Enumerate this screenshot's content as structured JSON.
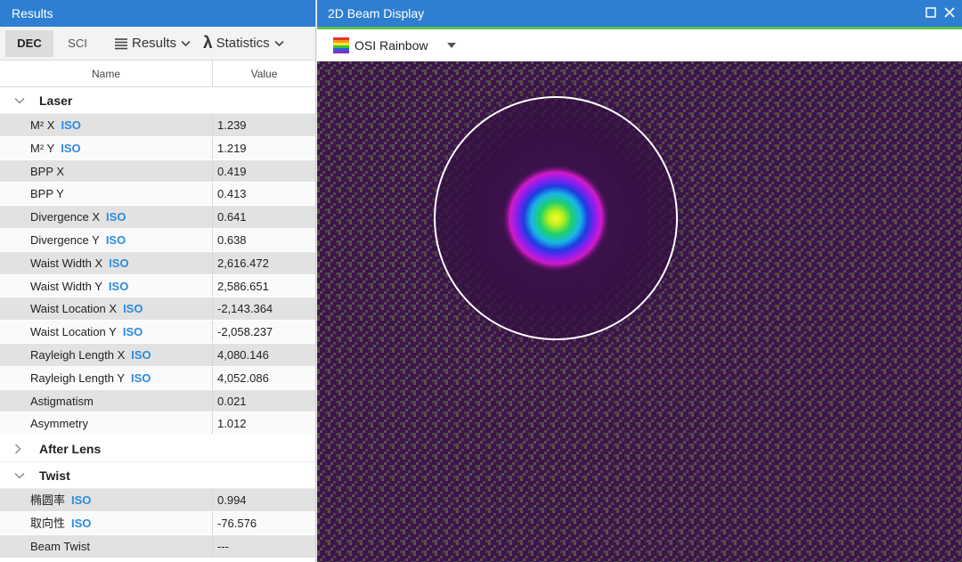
{
  "results": {
    "title": "Results",
    "toolbar": {
      "dec_label": "DEC",
      "sci_label": "SCI",
      "results_menu": "Results",
      "statistics_menu": "Statistics"
    },
    "columns": {
      "name": "Name",
      "value": "Value"
    },
    "iso_badge": "ISO",
    "groups": {
      "laser": {
        "title": "Laser",
        "rows": [
          {
            "name": "M² X",
            "iso": true,
            "value": "1.239"
          },
          {
            "name": "M² Y",
            "iso": true,
            "value": "1.219"
          },
          {
            "name": "BPP X",
            "iso": false,
            "value": "0.419"
          },
          {
            "name": "BPP Y",
            "iso": false,
            "value": "0.413"
          },
          {
            "name": "Divergence X",
            "iso": true,
            "value": "0.641"
          },
          {
            "name": "Divergence Y",
            "iso": true,
            "value": "0.638"
          },
          {
            "name": "Waist Width X",
            "iso": true,
            "value": "2,616.472"
          },
          {
            "name": "Waist Width Y",
            "iso": true,
            "value": "2,586.651"
          },
          {
            "name": "Waist Location X",
            "iso": true,
            "value": "-2,143.364"
          },
          {
            "name": "Waist Location Y",
            "iso": true,
            "value": "-2,058.237"
          },
          {
            "name": "Rayleigh Length X",
            "iso": true,
            "value": "4,080.146"
          },
          {
            "name": "Rayleigh Length Y",
            "iso": true,
            "value": "4,052.086"
          },
          {
            "name": "Astigmatism",
            "iso": false,
            "value": "0.021"
          },
          {
            "name": "Asymmetry",
            "iso": false,
            "value": "1.012"
          }
        ]
      },
      "after_lens": {
        "title": "After Lens"
      },
      "twist": {
        "title": "Twist",
        "rows": [
          {
            "name": "椭圆率",
            "iso": true,
            "value": "0.994"
          },
          {
            "name": "取向性",
            "iso": true,
            "value": "-76.576"
          },
          {
            "name": "Beam Twist",
            "iso": false,
            "value": "---"
          }
        ]
      }
    }
  },
  "beam_display": {
    "title": "2D Beam Display",
    "palette_label": "OSI Rainbow",
    "colors": {
      "title_bar": "#2e7fd1",
      "accent": "#5cc24a",
      "background": "#3a1448",
      "iso_text": "#2b8be0"
    }
  }
}
